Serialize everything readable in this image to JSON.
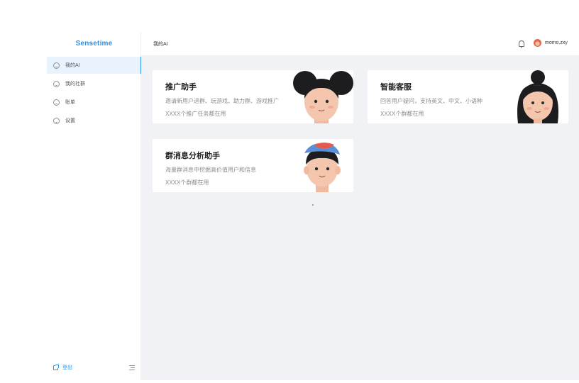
{
  "brand": "Sensetime",
  "sidebar": {
    "items": [
      {
        "label": "我的AI",
        "active": true,
        "icon": "smile-icon"
      },
      {
        "label": "我的社群",
        "active": false,
        "icon": "smile-icon"
      },
      {
        "label": "账单",
        "active": false,
        "icon": "smile-icon"
      },
      {
        "label": "设置",
        "active": false,
        "icon": "smile-icon"
      }
    ],
    "logout_label": "登出"
  },
  "header": {
    "title": "我的AI",
    "username": "momo.zxy"
  },
  "cards": [
    {
      "title": "推广助手",
      "desc": "邀请新用户进群、玩游戏、助力群、游戏推广",
      "usage": "XXXX个推广任务都在用",
      "avatar": "bun-hair-girl-avatar"
    },
    {
      "title": "智能客服",
      "desc": "回答用户疑问，支持英文、中文、小语种",
      "usage": "XXXX个群都在用",
      "avatar": "top-bun-girl-avatar"
    },
    {
      "title": "群消息分析助手",
      "desc": "海量群消息中挖掘高价值用户和信息",
      "usage": "XXXX个群都在用",
      "avatar": "cap-boy-avatar"
    }
  ],
  "colors": {
    "accent": "#2b8ee8",
    "background": "#f0f2f5",
    "active_nav": "#e8f3fd"
  }
}
